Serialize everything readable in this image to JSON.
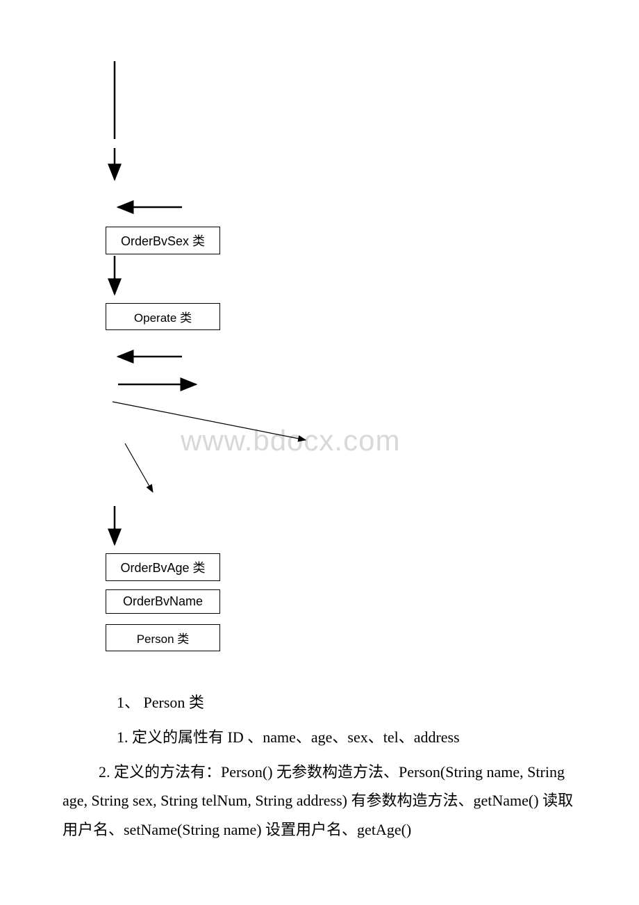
{
  "watermark": "www.bdocx.com",
  "boxes": {
    "orderBySex": "OrderBvSex 类",
    "operate": "Operate 类",
    "orderByAge": "OrderBvAge 类",
    "orderByName": "OrderBvName",
    "person": "Person 类"
  },
  "text": {
    "line1": "1、 Person 类",
    "line2": "1. 定义的属性有 ID 、name、age、sex、tel、address",
    "line3": "2. 定义的方法有：Person() 无参数构造方法、Person(String name, String age, String sex, String telNum, String address) 有参数构造方法、getName() 读取用户名、setName(String name) 设置用户名、getAge()"
  }
}
